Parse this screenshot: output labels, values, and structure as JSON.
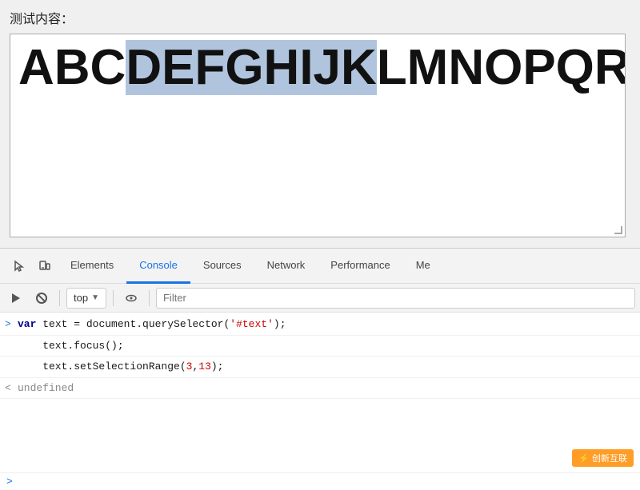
{
  "page": {
    "label": "测试内容：",
    "textarea_text_before": "ABC",
    "textarea_text_selected": "DEFGHIJK",
    "textarea_text_after": "LMNOPQRSTUV"
  },
  "devtools": {
    "tabs": [
      {
        "id": "elements",
        "label": "Elements",
        "active": false
      },
      {
        "id": "console",
        "label": "Console",
        "active": true
      },
      {
        "id": "sources",
        "label": "Sources",
        "active": false
      },
      {
        "id": "network",
        "label": "Network",
        "active": false
      },
      {
        "id": "performance",
        "label": "Performance",
        "active": false
      },
      {
        "id": "more",
        "label": "Me",
        "active": false
      }
    ],
    "toolbar": {
      "context_label": "top",
      "filter_placeholder": "Filter"
    },
    "console_lines": [
      {
        "type": "prompt",
        "arrow": ">",
        "html_id": "line1"
      },
      {
        "type": "result",
        "arrow": "<",
        "value": "undefined",
        "html_id": "line2"
      }
    ],
    "code_line1": "var text = document.querySelector(",
    "code_str1": "'#text'",
    "code_line1_end": ");",
    "code_line2": "text.focus();",
    "code_line3_start": "text.setSelectionRange(",
    "code_num1": "3",
    "code_comma": ",",
    "code_num2": "13",
    "code_line3_end": ");"
  },
  "watermark": {
    "icon": "创新互联",
    "text": "创新互联"
  }
}
